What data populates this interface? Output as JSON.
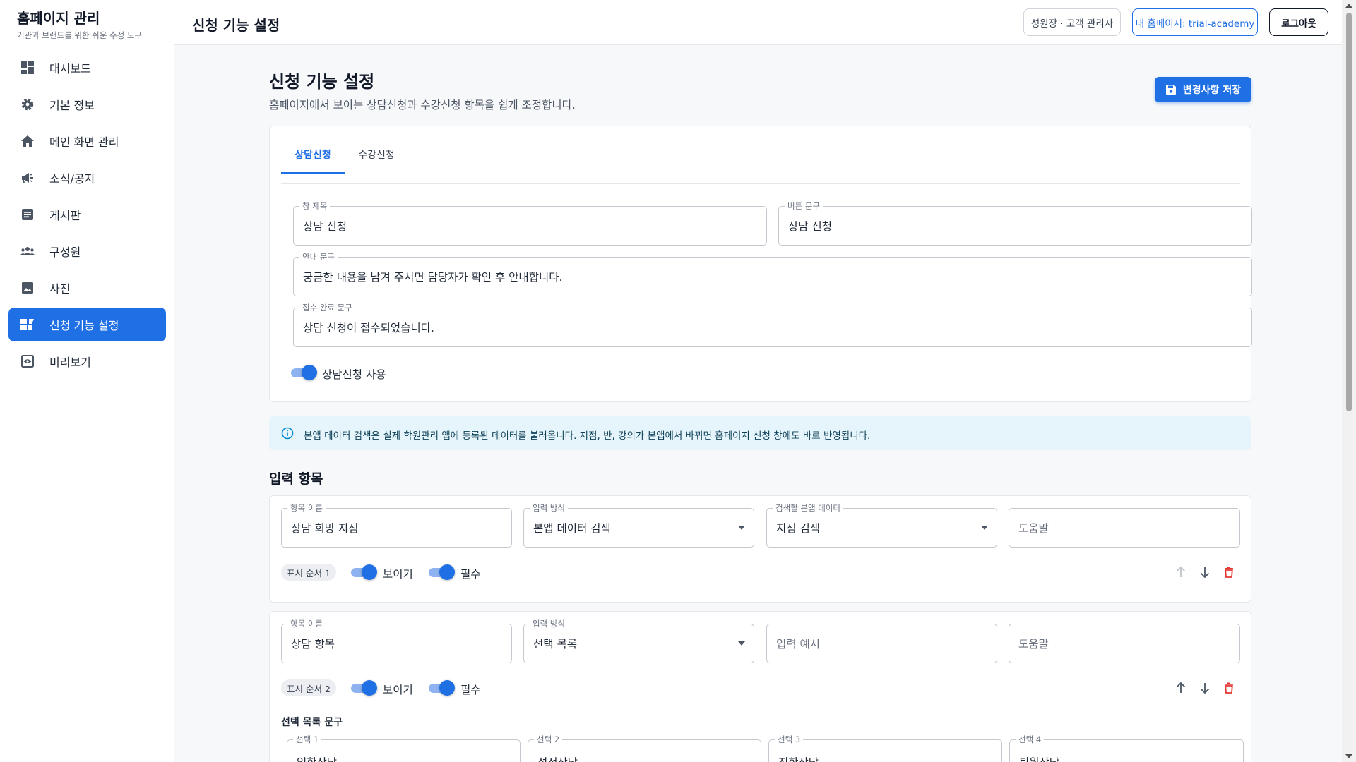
{
  "app": {
    "title": "홈페이지 관리",
    "subtitle": "기관과 브랜드를 위한 쉬운 수정 도구"
  },
  "sidebar": {
    "items": [
      {
        "label": "대시보드",
        "icon": "dashboard-icon",
        "active": false
      },
      {
        "label": "기본 정보",
        "icon": "gear-icon",
        "active": false
      },
      {
        "label": "메인 화면 관리",
        "icon": "home-icon",
        "active": false
      },
      {
        "label": "소식/공지",
        "icon": "megaphone-icon",
        "active": false
      },
      {
        "label": "게시판",
        "icon": "article-icon",
        "active": false
      },
      {
        "label": "구성원",
        "icon": "group-icon",
        "active": false
      },
      {
        "label": "사진",
        "icon": "image-icon",
        "active": false
      },
      {
        "label": "신청 기능 설정",
        "icon": "application-settings-icon",
        "active": true
      },
      {
        "label": "미리보기",
        "icon": "preview-icon",
        "active": false
      }
    ]
  },
  "header": {
    "title": "신청 기능 설정",
    "role_label": "성원장 · 고객 관리자",
    "mypage_label": "내 홈페이지: trial-academy",
    "logout_label": "로그아웃"
  },
  "page": {
    "title": "신청 기능 설정",
    "description": "홈페이지에서 보이는 상담신청과 수강신청 항목을 쉽게 조정합니다.",
    "save_label": "변경사항 저장"
  },
  "tabs": [
    {
      "label": "상담신청",
      "active": true
    },
    {
      "label": "수강신청",
      "active": false
    }
  ],
  "consult": {
    "window_title": {
      "label": "창 제목",
      "value": "상담 신청"
    },
    "button_text": {
      "label": "버튼 문구",
      "value": "상담 신청"
    },
    "guide_text": {
      "label": "안내 문구",
      "value": "궁금한 내용을 남겨 주시면 담당자가 확인 후 안내합니다."
    },
    "complete_text": {
      "label": "접수 완료 문구",
      "value": "상담 신청이 접수되었습니다."
    },
    "enabled": {
      "label": "상담신청 사용",
      "on": true
    }
  },
  "info_message": "본앱 데이터 검색은 실제 학원관리 앱에 등록된 데이터를 불러옵니다. 지점, 반, 강의가 본앱에서 바뀌면 홈페이지 신청 창에도 바로 반영됩니다.",
  "input_items": {
    "title": "입력 항목",
    "items": [
      {
        "name_label": "항목 이름",
        "name": "상담 희망 지점",
        "method_label": "입력 방식",
        "method": "본앱 데이터 검색",
        "third_label": "검색할 본앱 데이터",
        "third": "지점 검색",
        "help_placeholder": "도움말",
        "order": "표시 순서 1",
        "visible_label": "보이기",
        "visible": true,
        "required_label": "필수",
        "required": true
      },
      {
        "name_label": "항목 이름",
        "name": "상담 항목",
        "method_label": "입력 방식",
        "method": "선택 목록",
        "example_placeholder": "입력 예시",
        "help_placeholder": "도움말",
        "order": "표시 순서 2",
        "visible_label": "보이기",
        "visible": true,
        "required_label": "필수",
        "required": true,
        "options_title": "선택 목록 문구",
        "options": [
          {
            "label": "선택 1",
            "value": "입학상담"
          },
          {
            "label": "선택 2",
            "value": "성적상담"
          },
          {
            "label": "선택 3",
            "value": "진학상담"
          },
          {
            "label": "선택 4",
            "value": "퇴원상담"
          }
        ]
      }
    ]
  },
  "colors": {
    "accent": "#1f6fe5",
    "danger": "#e53935",
    "info_bg": "#e5f5fb"
  }
}
